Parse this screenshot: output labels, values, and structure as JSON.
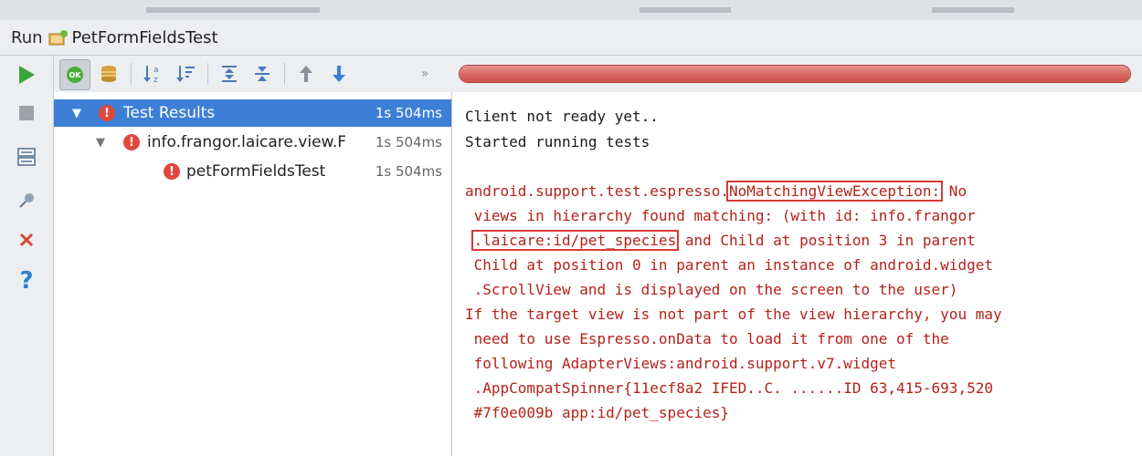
{
  "run_panel": {
    "run_label": "Run",
    "config_name": "PetFormFieldsTest"
  },
  "left_toolbar": {
    "buttons": [
      "run-icon",
      "stop-icon",
      "layout-icon",
      "pin-icon",
      "close-icon",
      "help-icon"
    ]
  },
  "tree_toolbar": {
    "buttons": [
      "ok-filter-icon",
      "ignored-filter-icon",
      "sort-alpha-icon",
      "sort-duration-icon",
      "expand-all-icon",
      "collapse-all-icon",
      "prev-failed-icon",
      "next-failed-icon",
      "more-icon"
    ],
    "more_label": "»"
  },
  "progress": {
    "fraction": 1.0,
    "status_color": "#d9605b"
  },
  "test_tree": {
    "rows": [
      {
        "label": "Test Results",
        "duration": "1s 504ms",
        "level": 0,
        "expanded": true,
        "selected": true
      },
      {
        "label": "info.frangor.laicare.view.F",
        "duration": "1s 504ms",
        "level": 1,
        "expanded": true,
        "selected": false
      },
      {
        "label": "petFormFieldsTest",
        "duration": "1s 504ms",
        "level": 2,
        "expanded": false,
        "selected": false
      }
    ]
  },
  "console": {
    "line1": "Client not ready yet..",
    "line2": "Started running tests",
    "err_prefix": "android.support.test.espresso.",
    "exception_name": "NoMatchingViewException:",
    "err_suffix": " No",
    "line4": " views in hierarchy found matching: (with id: info.frangor",
    "line5_pre": " ",
    "highlight_id": ".laicare:id/pet_species",
    "line5_post": " and Child at position 3 in parent",
    "line6": " Child at position 0 in parent an instance of android.widget",
    "line7": " .ScrollView and is displayed on the screen to the user)",
    "line8": "If the target view is not part of the view hierarchy, you may",
    "line9": " need to use Espresso.onData to load it from one of the",
    "line10": " following AdapterViews:android.support.v7.widget",
    "line11": " .AppCompatSpinner{11ecf8a2 IFED..C. ......ID 63,415-693,520",
    "line12": " #7f0e009b app:id/pet_species}"
  },
  "colors": {
    "error_text": "#b4221a",
    "highlight_box": "#d63a35",
    "selection": "#3d7fd6",
    "run_green": "#3aa53a"
  }
}
